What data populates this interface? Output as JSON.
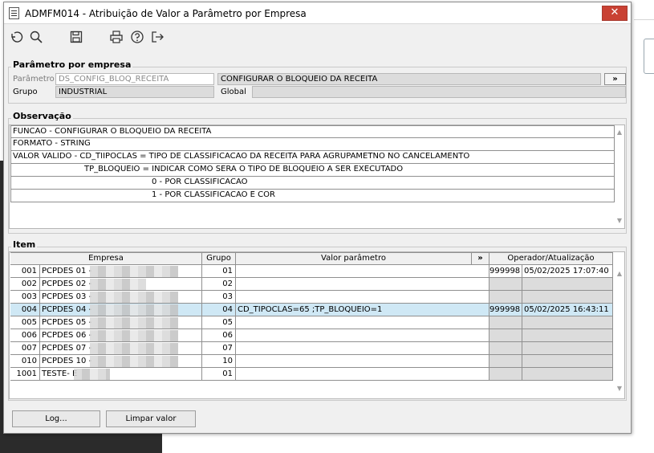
{
  "window": {
    "title": "ADMFM014 - Atribuição de Valor a Parâmetro por Empresa",
    "close": "✕"
  },
  "toolbar": {
    "icons": [
      "undo-icon",
      "search-icon",
      "save-icon",
      "print-icon",
      "help-icon",
      "exit-icon"
    ]
  },
  "param_group": {
    "title": "Parâmetro por empresa",
    "param_label": "Parâmetro",
    "param_value": "DS_CONFIG_BLOQ_RECEITA",
    "param_desc": "CONFIGURAR O BLOQUEIO DA RECEITA",
    "expand_btn": "»",
    "group_label": "Grupo",
    "group_value": "INDUSTRIAL",
    "global_label": "Global",
    "global_value": ""
  },
  "obs_group": {
    "title": "Observação",
    "lines": [
      "FUNCAO - CONFIGURAR O BLOQUEIO DA RECEITA",
      "FORMATO - STRING",
      "VALOR VALIDO - CD_TIIPOCLAS = TIPO DE CLASSIFICACAO DA RECEITA PARA AGRUPAMETNO NO CANCELAMENTO",
      "TP_BLOQUEIO = INDICAR COMO SERA O TIPO DE BLOQUEIO A SER EXECUTADO",
      "0 - POR CLASSIFICACAO",
      "1 - POR CLASSIFICACAO E COR"
    ]
  },
  "item_group": {
    "title": "Item",
    "columns": {
      "empresa": "Empresa",
      "grupo": "Grupo",
      "valor": "Valor parâmetro",
      "expand": "»",
      "operador": "Operador/Atualização"
    },
    "rows": [
      {
        "code": "001",
        "name": "PCPDES 01 -",
        "grupo": "01",
        "valor": "",
        "operador": "999998",
        "data": "05/02/2025 17:07:40"
      },
      {
        "code": "002",
        "name": "PCPDES 02 -",
        "grupo": "02",
        "valor": "",
        "operador": "",
        "data": ""
      },
      {
        "code": "003",
        "name": "PCPDES 03 -",
        "grupo": "03",
        "valor": "",
        "operador": "",
        "data": ""
      },
      {
        "code": "004",
        "name": "PCPDES 04 -",
        "grupo": "04",
        "valor": "CD_TIPOCLAS=65 ;TP_BLOQUEIO=1",
        "operador": "999998",
        "data": "05/02/2025 16:43:11"
      },
      {
        "code": "005",
        "name": "PCPDES 05 -",
        "grupo": "05",
        "valor": "",
        "operador": "",
        "data": ""
      },
      {
        "code": "006",
        "name": "PCPDES 06 -",
        "grupo": "06",
        "valor": "",
        "operador": "",
        "data": ""
      },
      {
        "code": "007",
        "name": "PCPDES 07 -",
        "grupo": "07",
        "valor": "",
        "operador": "",
        "data": ""
      },
      {
        "code": "010",
        "name": "PCPDES 10 -",
        "grupo": "10",
        "valor": "",
        "operador": "",
        "data": ""
      },
      {
        "code": "1001",
        "name": "TESTE- E",
        "grupo": "01",
        "valor": "",
        "operador": "",
        "data": ""
      }
    ]
  },
  "buttons": {
    "log": "Log...",
    "clear": "Limpar valor"
  }
}
